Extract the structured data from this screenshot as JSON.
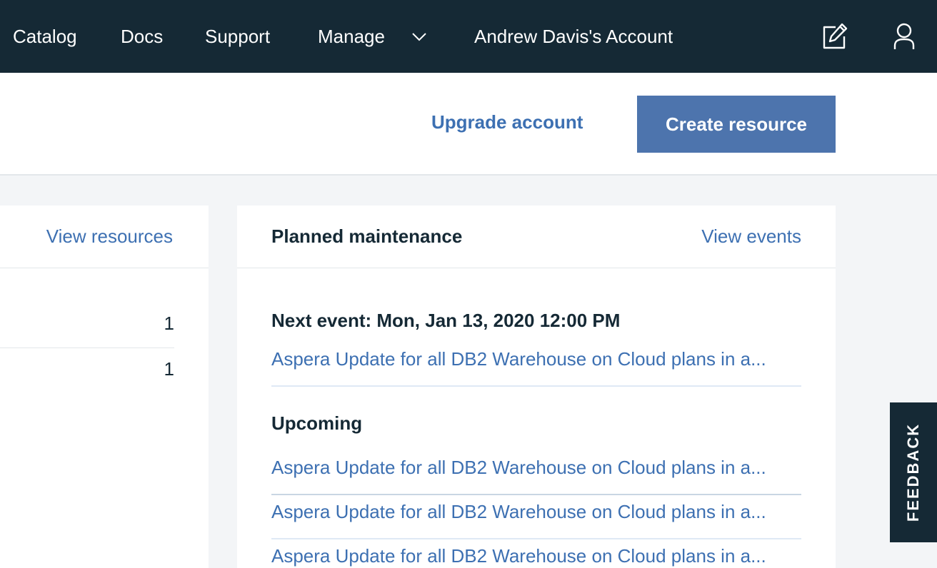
{
  "nav": {
    "items": [
      {
        "label": "Catalog"
      },
      {
        "label": "Docs"
      },
      {
        "label": "Support"
      },
      {
        "label": "Manage"
      }
    ],
    "manage_chevron": "chevron-down-icon",
    "account": "Andrew Davis's Account",
    "edit_icon": "edit-icon",
    "user_icon": "user-icon"
  },
  "actions": {
    "upgrade": "Upgrade account",
    "create": "Create resource"
  },
  "resources_card": {
    "link": "View resources",
    "counts": [
      "1",
      "1"
    ]
  },
  "maintenance_card": {
    "title": "Planned maintenance",
    "link": "View events",
    "next_event_heading": "Next event: Mon, Jan 13, 2020 12:00 PM",
    "next_event": "Aspera Update for all DB2 Warehouse on Cloud plans in a...",
    "upcoming_heading": "Upcoming",
    "upcoming": [
      "Aspera Update for all DB2 Warehouse on Cloud plans in a...",
      "Aspera Update for all DB2 Warehouse on Cloud plans in a...",
      "Aspera Update for all DB2 Warehouse on Cloud plans in a..."
    ]
  },
  "feedback": "FEEDBACK",
  "colors": {
    "nav_bg": "#152935",
    "accent": "#3d70b2",
    "button_bg": "#4d74ad",
    "page_bg": "#f3f5f7"
  }
}
